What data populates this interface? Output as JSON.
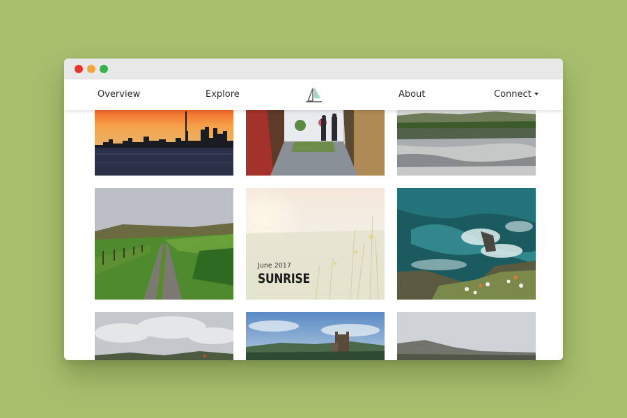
{
  "window": {
    "controls": [
      "close",
      "minimize",
      "maximize"
    ]
  },
  "nav": {
    "overview": "Overview",
    "explore": "Explore",
    "about": "About",
    "connect": "Connect",
    "logo_icon": "sailboat-icon"
  },
  "gallery": {
    "featured": {
      "date": "June 2017",
      "title": "SUNRISE"
    },
    "tiles": [
      "city-skyline-sunset",
      "alley-couple-walking",
      "lake-reflection",
      "countryside-path",
      "sunrise-meadow",
      "ocean-rocks-aerial",
      "cloudy-hills",
      "castle-landscape",
      "misty-mountains"
    ]
  },
  "colors": {
    "background": "#a8bf6e",
    "window_close": "#e8362f",
    "window_minimize": "#f5a33b",
    "window_maximize": "#37b24a",
    "logo_accent": "#9fd8c8"
  }
}
